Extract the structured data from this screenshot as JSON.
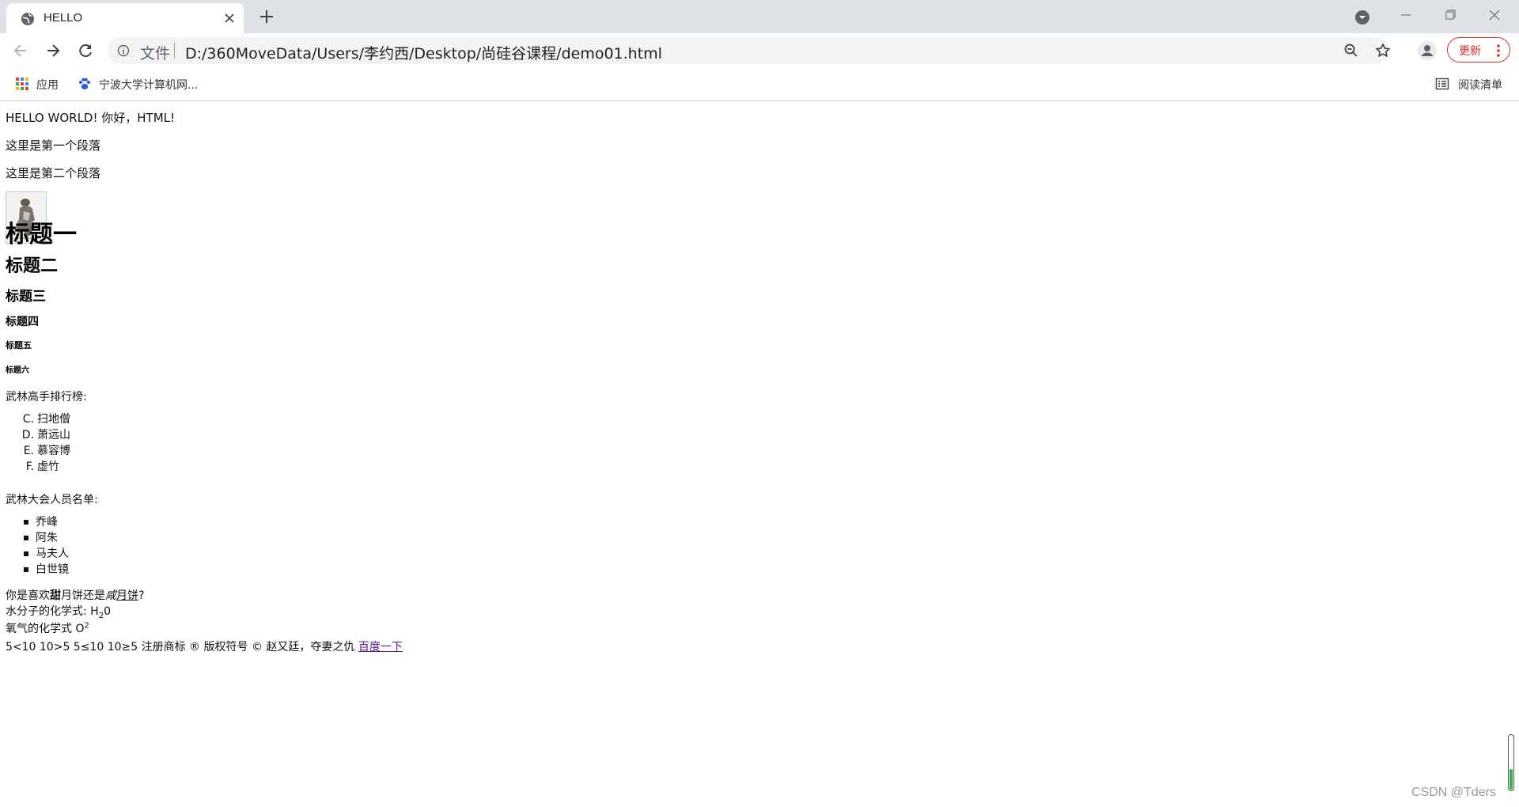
{
  "tab": {
    "title": "HELLO"
  },
  "address_bar": {
    "scheme_label": "文件",
    "url": "D:/360MoveData/Users/李约西/Desktop/尚硅谷课程/demo01.html"
  },
  "toolbar": {
    "update_label": "更新"
  },
  "bookmarks": {
    "apps_label": "应用",
    "items": [
      {
        "label": "宁波大学计算机网..."
      }
    ],
    "reading_list_label": "阅读清单"
  },
  "content": {
    "hello_line": "HELLO WORLD!   你好，HTML!",
    "paragraph1": "这里是第一个段落",
    "paragraph2": "这里是第二个段落",
    "headings": {
      "h1": "标题一",
      "h2": "标题二",
      "h3": "标题三",
      "h4": "标题四",
      "h5": "标题五",
      "h6": "标题六"
    },
    "ranking_label": "武林高手排行榜:",
    "ordered_list": [
      {
        "marker": "C.",
        "text": "扫地僧"
      },
      {
        "marker": "D.",
        "text": "萧远山"
      },
      {
        "marker": "E.",
        "text": "慕容博"
      },
      {
        "marker": "F.",
        "text": "虚竹"
      }
    ],
    "members_label": "武林大会人员名单:",
    "unordered_list": [
      "乔峰",
      "阿朱",
      "马夫人",
      "白世镜"
    ],
    "mooncake": {
      "prefix": "你是喜欢",
      "bold": "甜",
      "middle": "月饼还是",
      "italic": "咸",
      "underlined": "月饼",
      "suffix": "?"
    },
    "water": {
      "prefix": "水分子的化学式: H",
      "sub": "2",
      "suffix": "0"
    },
    "oxygen": {
      "prefix": "氧气的化学式 O",
      "sup": "2"
    },
    "entities_line": "5<10 10>5 5≤10 10≥5 注册商标 ® 版权符号 © 赵又廷，夺妻之仇",
    "link_text": "百度一下"
  },
  "watermark": "CSDN @Tders",
  "colors": {
    "tabstrip_bg": "#dee1e6",
    "omnibox_bg": "#f1f3f4",
    "update_red": "#d93025",
    "visited_link": "#551a8b",
    "scroll_green": "#37b24d"
  },
  "icons": [
    "globe-icon",
    "close-icon",
    "plus-icon",
    "profile-dropdown-icon",
    "minimize-icon",
    "restore-icon",
    "window-close-icon",
    "back-arrow-icon",
    "forward-arrow-icon",
    "reload-icon",
    "info-icon",
    "zoom-icon",
    "star-icon",
    "avatar-icon",
    "more-vert-icon",
    "apps-grid-icon",
    "paw-icon",
    "reading-list-icon"
  ]
}
